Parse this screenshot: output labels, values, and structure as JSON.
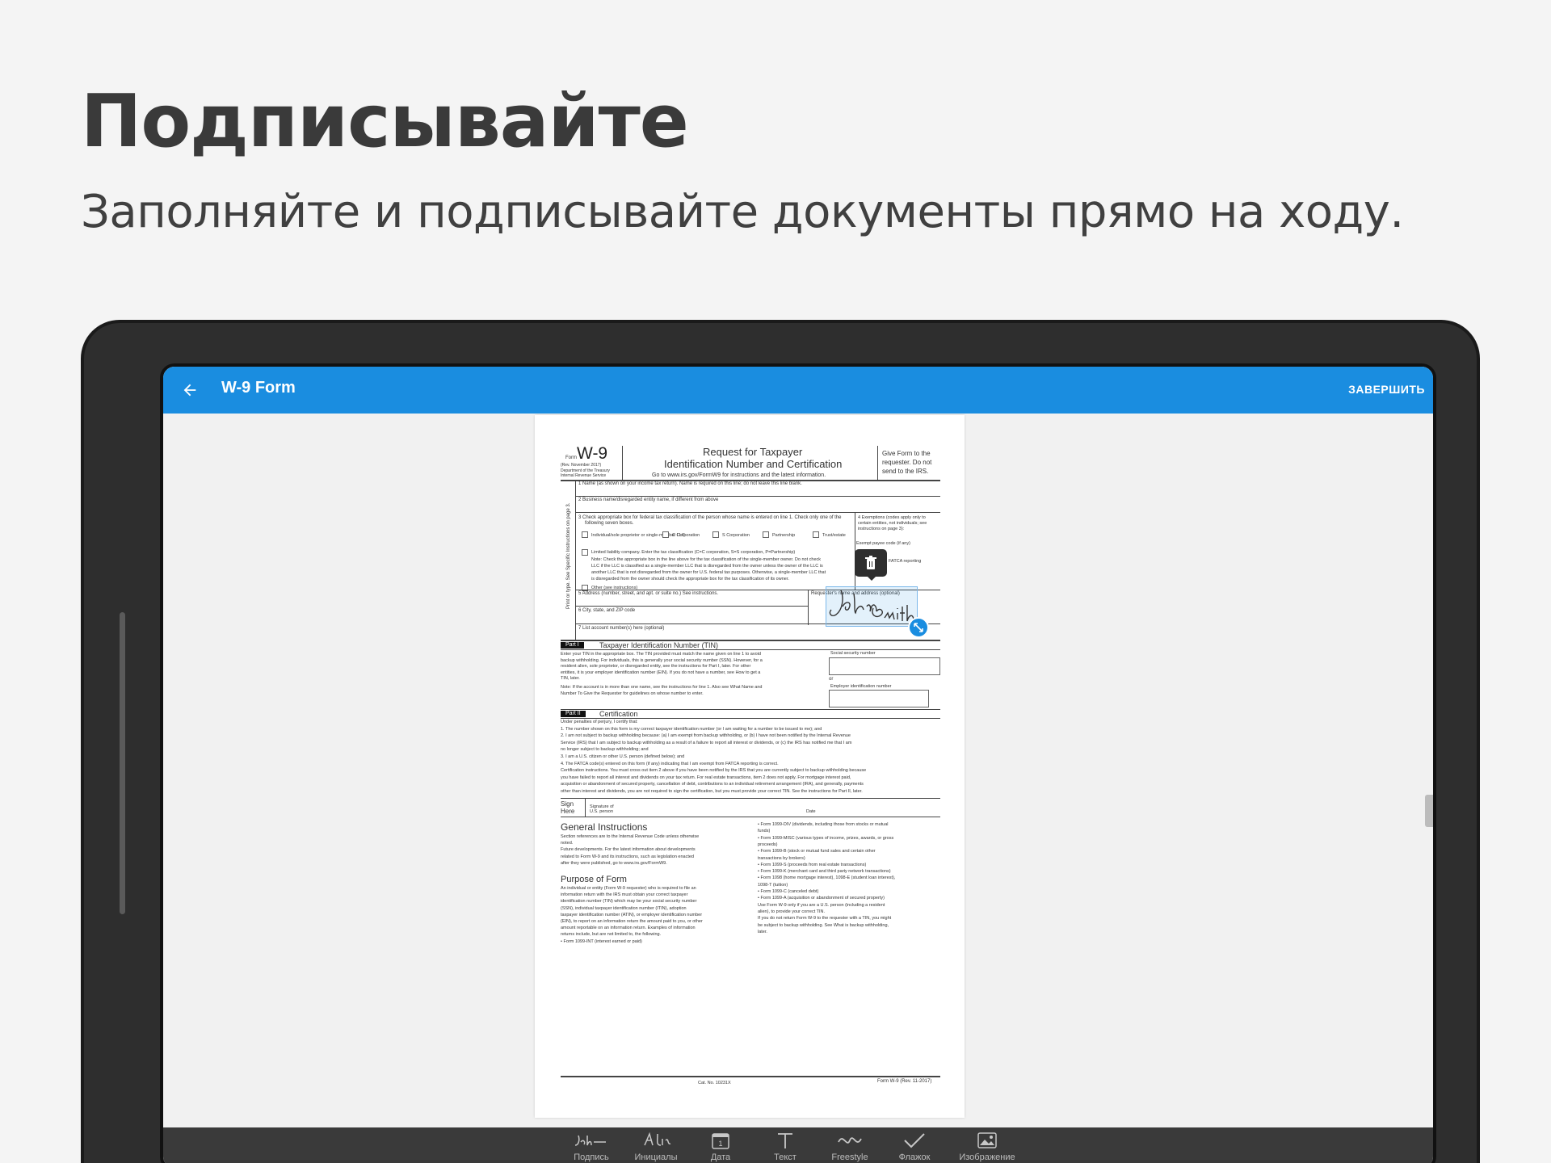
{
  "headline": "Подписывайте",
  "subheadline": "Заполняйте и подписывайте документы прямо на ходу.",
  "app": {
    "title": "W-9 Form",
    "finish_label": "ЗАВЕРШИТЬ",
    "accent": "#1a8de0"
  },
  "document": {
    "form_label": "Form",
    "form_name": "W-9",
    "rev": "(Rev. November 2017)",
    "dept1": "Department of the Treasury",
    "dept2": "Internal Revenue Service",
    "title1": "Request for Taxpayer",
    "title2": "Identification Number and Certification",
    "goto": "Go to www.irs.gov/FormW9 for instructions and the latest information.",
    "give1": "Give Form to the",
    "give2": "requester. Do not",
    "give3": "send to the IRS.",
    "line1": "1 Name (as shown on your income tax return). Name is required on this line; do not leave this line blank.",
    "line2": "2 Business name/disregarded entity name, if different from above",
    "line3a": "3 Check appropriate box for federal tax classification of the person whose name is entered on line 1. Check only one of the",
    "line3b": "following seven boxes.",
    "cb_individual": "Individual/sole proprietor or single-member LLC",
    "cb_ccorp": "C Corporation",
    "cb_scorp": "S Corporation",
    "cb_partnership": "Partnership",
    "cb_trust": "Trust/estate",
    "llc": "Limited liability company. Enter the tax classification (C=C corporation, S=S corporation, P=Partnership)",
    "note1": "Note: Check the appropriate box in the line above for the tax classification of the single-member owner. Do not check",
    "note2": "LLC if the LLC is classified as a single-member LLC that is disregarded from the owner unless the owner of the LLC is",
    "note3": "another LLC that is not disregarded from the owner for U.S. federal tax purposes. Otherwise, a single-member LLC that",
    "note4": "is disregarded from the owner should check the appropriate box for the tax classification of its owner.",
    "other": "Other (see instructions)",
    "exempt1": "4 Exemptions (codes apply only to",
    "exempt2": "certain entities, not individuals; see",
    "exempt3": "instructions on page 3):",
    "exempt_payee": "Exempt payee code (if any)",
    "fatca": "FATCA reporting",
    "line5": "5 Address (number, street, and apt. or suite no.) See instructions.",
    "requester": "Requester's name and address (optional)",
    "line6": "6 City, state, and ZIP code",
    "line7": "7 List account number(s) here (optional)",
    "side_label": "Print or type. See Specific Instructions on page 3.",
    "part1_tag": "Part I",
    "part1_title": "Taxpayer Identification Number (TIN)",
    "part1_text": [
      "Enter your TIN in the appropriate box. The TIN provided must match the name given on line 1 to avoid",
      "backup withholding. For individuals, this is generally your social security number (SSN). However, for a",
      "resident alien, sole proprietor, or disregarded entity, see the instructions for Part I, later. For other",
      "entities, it is your employer identification number (EIN). If you do not have a number, see How to get a",
      "TIN, later."
    ],
    "part1_note": [
      "Note: If the account is in more than one name, see the instructions for line 1. Also see What Name and",
      "Number To Give the Requester for guidelines on whose number to enter."
    ],
    "ssn_label": "Social security number",
    "or_label": "or",
    "ein_label": "Employer identification number",
    "part2_tag": "Part II",
    "part2_title": "Certification",
    "cert_text": [
      "Under penalties of perjury, I certify that:",
      "1. The number shown on this form is my correct taxpayer identification number (or I am waiting for a number to be issued to me); and",
      "2. I am not subject to backup withholding because: (a) I am exempt from backup withholding, or (b) I have not been notified by the Internal Revenue",
      "   Service (IRS) that I am subject to backup withholding as a result of a failure to report all interest or dividends, or (c) the IRS has notified me that I am",
      "   no longer subject to backup withholding; and",
      "3. I am a U.S. citizen or other U.S. person (defined below); and",
      "4. The FATCA code(s) entered on this form (if any) indicating that I am exempt from FATCA reporting is correct.",
      "Certification instructions. You must cross out item 2 above if you have been notified by the IRS that you are currently subject to backup withholding because",
      "you have failed to report all interest and dividends on your tax return. For real estate transactions, item 2 does not apply. For mortgage interest paid,",
      "acquisition or abandonment of secured property, cancellation of debt, contributions to an individual retirement arrangement (IRA), and generally, payments",
      "other than interest and dividends, you are not required to sign the certification, but you must provide your correct TIN. See the instructions for Part II, later."
    ],
    "sign_here": "Sign Here",
    "sig_label": "Signature of U.S. person",
    "date_label": "Date",
    "gi_title": "General Instructions",
    "gi_text": [
      "Section references are to the Internal Revenue Code unless otherwise",
      "noted.",
      "Future developments. For the latest information about developments",
      "related to Form W-9 and its instructions, such as legislation enacted",
      "after they were published, go to www.irs.gov/FormW9."
    ],
    "purpose_title": "Purpose of Form",
    "purpose_text": [
      "An individual or entity (Form W-9 requester) who is required to file an",
      "information return with the IRS must obtain your correct taxpayer",
      "identification number (TIN) which may be your social security number",
      "(SSN), individual taxpayer identification number (ITIN), adoption",
      "taxpayer identification number (ATIN), or employer identification number",
      "(EIN), to report on an information return the amount paid to you, or other",
      "amount reportable on an information return. Examples of information",
      "returns include, but are not limited to, the following.",
      "• Form 1099-INT (interest earned or paid)"
    ],
    "right_col": [
      "• Form 1099-DIV (dividends, including those from stocks or mutual",
      "funds)",
      "• Form 1099-MISC (various types of income, prizes, awards, or gross",
      "proceeds)",
      "• Form 1099-B (stock or mutual fund sales and certain other",
      "transactions by brokers)",
      "• Form 1099-S (proceeds from real estate transactions)",
      "• Form 1099-K (merchant card and third party network transactions)",
      "• Form 1098 (home mortgage interest), 1098-E (student loan interest),",
      "1098-T (tuition)",
      "• Form 1099-C (canceled debt)",
      "• Form 1099-A (acquisition or abandonment of secured property)",
      "Use Form W-9 only if you are a U.S. person (including a resident",
      "alien), to provide your correct TIN.",
      "If you do not return Form W-9 to the requester with a TIN, you might",
      "be subject to backup withholding. See What is backup withholding,",
      "later."
    ],
    "cat_no": "Cat. No. 10231X",
    "footer_form": "Form W-9 (Rev. 11-2017)",
    "signature_text": "John Smith"
  },
  "toolbar": [
    {
      "label": "Подпись",
      "icon": "signature-icon"
    },
    {
      "label": "Инициалы",
      "icon": "initials-icon"
    },
    {
      "label": "Дата",
      "icon": "calendar-icon"
    },
    {
      "label": "Текст",
      "icon": "text-icon"
    },
    {
      "label": "Freestyle",
      "icon": "freestyle-icon"
    },
    {
      "label": "Флажок",
      "icon": "checkmark-icon"
    },
    {
      "label": "Изображение",
      "icon": "image-icon"
    }
  ]
}
